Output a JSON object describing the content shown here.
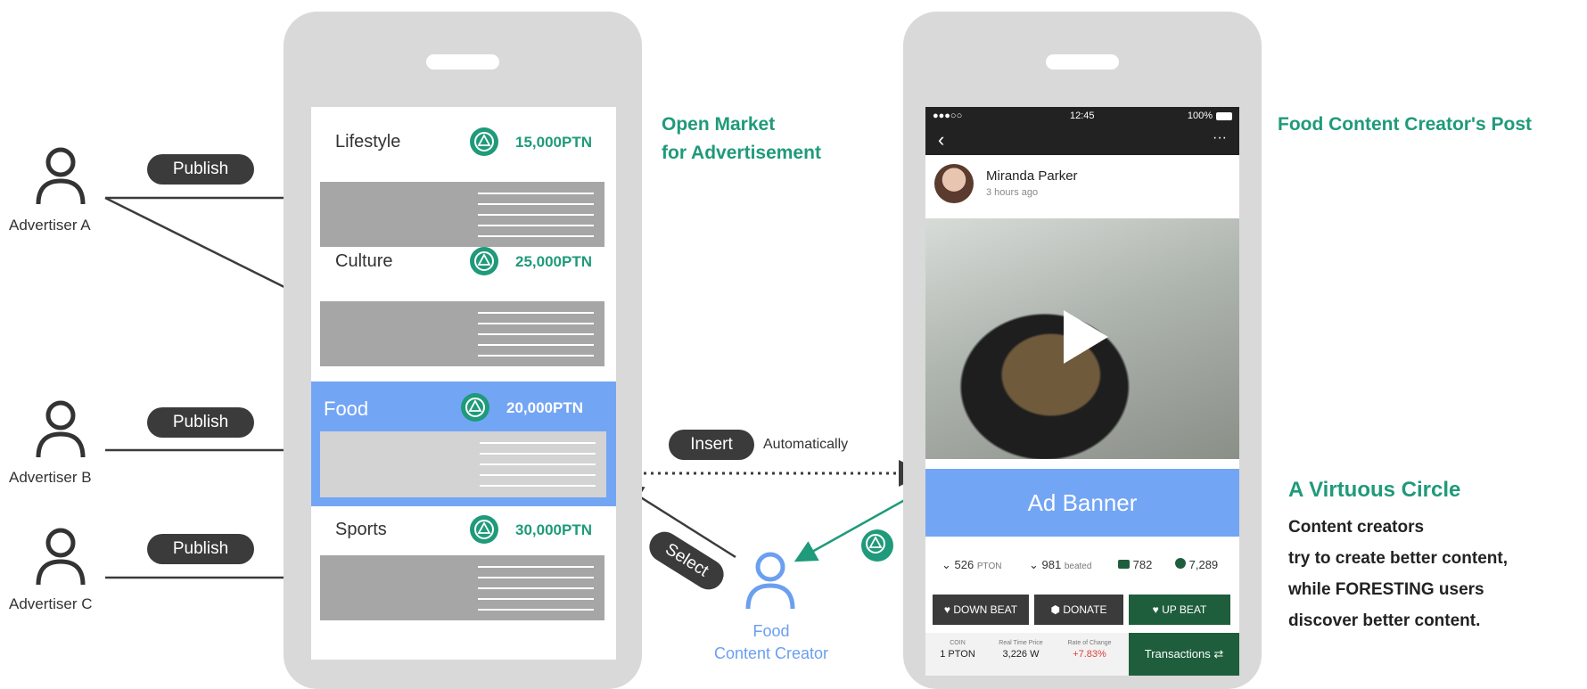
{
  "advertisers": [
    {
      "name": "Advertiser A",
      "action": "Publish"
    },
    {
      "name": "Advertiser B",
      "action": "Publish"
    },
    {
      "name": "Advertiser C",
      "action": "Publish"
    }
  ],
  "market": {
    "heading_line1": "Open Market",
    "heading_line2": "for Advertisement",
    "categories": [
      {
        "name": "Lifestyle",
        "price": "15,000PTN"
      },
      {
        "name": "Culture",
        "price": "25,000PTN"
      },
      {
        "name": "Food",
        "price": "20,000PTN"
      },
      {
        "name": "Sports",
        "price": "30,000PTN"
      }
    ]
  },
  "flow": {
    "insert_label": "Insert",
    "automatically_label": "Automatically",
    "select_label": "Select"
  },
  "creator": {
    "line1": "Food",
    "line2": "Content Creator"
  },
  "post": {
    "heading": "Food Content Creator's Post",
    "status_time": "12:45",
    "status_battery": "100%",
    "author": "Miranda Parker",
    "posted": "3 hours ago",
    "ad_banner": "Ad Banner",
    "stats": {
      "pton_value": "526",
      "pton_unit": "PTON",
      "beated_value": "981",
      "beated_unit": "beated",
      "comments": "782",
      "checks": "7,289"
    },
    "buttons": {
      "down_beat": "DOWN BEAT",
      "donate": "DONATE",
      "up_beat": "UP BEAT"
    },
    "bottom": {
      "coin_label": "COIN",
      "coin_value": "1 PTON",
      "price_label": "Real Time Price",
      "price_value": "3,226 W",
      "rate_label": "Rate of Change",
      "rate_value": "+7.83%",
      "transactions": "Transactions"
    }
  },
  "virtuous": {
    "heading": "A Virtuous Circle",
    "lines": [
      "Content creators",
      "try to create better content,",
      "while FORESTING users",
      "discover better content."
    ]
  },
  "colors": {
    "accent_green": "#1f9a7a",
    "highlight_blue": "#73a5f5",
    "dark_green": "#1e5e3c",
    "rate_red": "#e0403a"
  }
}
